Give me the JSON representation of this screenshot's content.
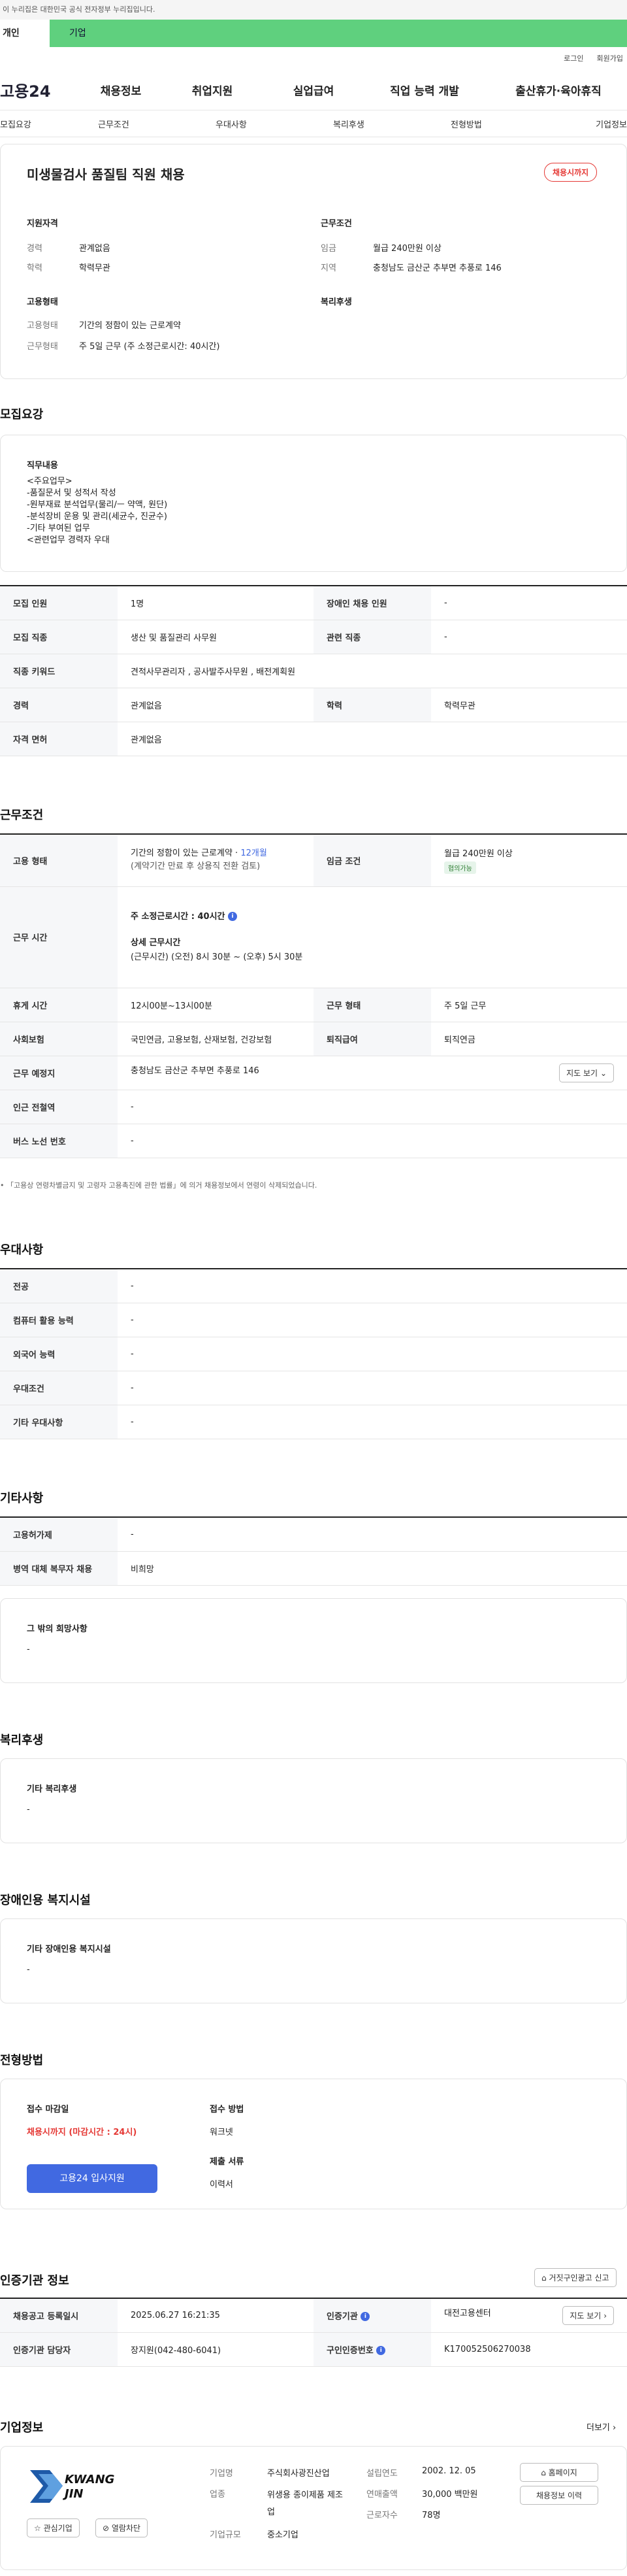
{
  "gov_banner": "이 누리집은 대한민국 공식 전자정부 누리집입니다.",
  "user_tabs": [
    "개인",
    "기업"
  ],
  "top_links": [
    "로그인",
    "회원가입"
  ],
  "logo": "고용24",
  "gnb": [
    "채용정보",
    "취업지원",
    "실업급여",
    "직업 능력 개발",
    "출산휴가·육아휴직"
  ],
  "subnav": [
    "모집요강",
    "근무조건",
    "우대사항",
    "복리후생",
    "전형방법",
    "기업정보"
  ],
  "job_title": "미생물검사 품질팀 직원 채용",
  "status_badge": "채용시까지",
  "summary": {
    "qual_title": "지원자격",
    "cond_title": "근무조건",
    "type_title": "고용형태",
    "welfare_title": "복리후생",
    "career_l": "경력",
    "career_v": "관계없음",
    "edu_l": "학력",
    "edu_v": "학력무관",
    "wage_l": "임금",
    "wage_v": "월급 240만원 이상",
    "area_l": "지역",
    "area_v": "충청남도 금산군 추부면 추풍로 146",
    "emp_l": "고용형태",
    "emp_v": "기간의 정함이 있는 근로계약",
    "work_l": "근무형태",
    "work_v": "주 5일 근무 (주 소정근로시간: 40시간)"
  },
  "recruit": {
    "title": "모집요강",
    "duty_title": "직무내용",
    "duty_lines": [
      "<주요업무>",
      "-품질문서 및 성적서 작성",
      "-원부재료 분석업무(물리/ㅡ 약액, 원단)",
      "-분석장비 운용 및 관리(세균수, 진균수)",
      "-기타 부여된 업무",
      "<관련업무 경력자 우대"
    ],
    "rows": [
      [
        "모집 인원",
        "1명",
        "장애인 채용 인원",
        "-"
      ],
      [
        "모집 직종",
        "생산 및 품질관리 사무원",
        "관련 직종",
        "-"
      ],
      [
        "직종 키워드",
        "견적사무관리자 , 공사발주사무원 , 배전계획원",
        "",
        ""
      ],
      [
        "경력",
        "관계없음",
        "학력",
        "학력무관"
      ],
      [
        "자격 면허",
        "관계없음",
        "",
        ""
      ]
    ]
  },
  "conditions": {
    "title": "근무조건",
    "emp_h": "고용 형태",
    "emp_v1": "기간의 정함이 있는 근로계약 · ",
    "emp_period": "12개월",
    "emp_v2": "(계약기간 만료 후 상용직 전환 검토)",
    "wage_h": "임금 조건",
    "wage_v": "월급 240만원 이상",
    "wage_chip": "협의가능",
    "hours_h": "근무 시간",
    "hours_main": "주 소정근로시간 : 40시간",
    "hours_detail_t": "상세 근무시간",
    "hours_detail": "(근무시간) (오전) 8시 30분 ~ (오후) 5시 30분",
    "break_h": "휴게 시간",
    "break_v": "12시00분~13시00분",
    "form_h": "근무 형태",
    "form_v": "주 5일 근무",
    "ins_h": "사회보험",
    "ins_v": "국민연금, 고용보험, 산재보험, 건강보험",
    "ret_h": "퇴직급여",
    "ret_v": "퇴직연금",
    "place_h": "근무 예정지",
    "place_v": "충청남도 금산군 추부면 추풍로 146",
    "map_btn": "지도 보기",
    "sub_h": "인근 전철역",
    "sub_v": "-",
    "bus_h": "버스 노선 번호",
    "bus_v": "-",
    "note": "「고용상 연령차별금지 및 고령자 고용촉진에 관한 법률」에 의거 채용정보에서 연령이 삭제되었습니다."
  },
  "pref": {
    "title": "우대사항",
    "rows": [
      [
        "전공",
        "-"
      ],
      [
        "컴퓨터 활용 능력",
        "-"
      ],
      [
        "외국어 능력",
        "-"
      ],
      [
        "우대조건",
        "-"
      ],
      [
        "기타 우대사항",
        "-"
      ]
    ]
  },
  "etc": {
    "title": "기타사항",
    "rows": [
      [
        "고용허가제",
        "-"
      ],
      [
        "병역 대체 복무자 채용",
        "비희망"
      ]
    ],
    "other_title": "그 밖의 희망사항",
    "other_v": "-"
  },
  "welfare": {
    "title": "복리후생",
    "sub": "기타 복리후생",
    "v": "-"
  },
  "disab": {
    "title": "장애인용 복지시설",
    "sub": "기타 장애인용 복지시설",
    "v": "-"
  },
  "process": {
    "title": "전형방법",
    "deadline_t": "접수 마감일",
    "deadline_v": "채용시까지 (마감시간 : 24시)",
    "method_t": "접수 방법",
    "method_v": "워크넷",
    "docs_t": "제출 서류",
    "docs_v": "이력서",
    "apply_btn": "고용24 입사지원"
  },
  "agency": {
    "title": "인증기관 정보",
    "report_btn": "거짓구인광고 신고",
    "reg_h": "채용공고 등록일시",
    "reg_v": "2025.06.27 16:21:35",
    "org_h": "인증기관",
    "org_v": "대전고용센터",
    "map_btn": "지도 보기",
    "mgr_h": "인증기관 담당자",
    "mgr_v": "장지원(042-480-6041)",
    "no_h": "구인인증번호",
    "no_v": "K170052506270038"
  },
  "company": {
    "title": "기업정보",
    "more": "더보기",
    "logo_main": "KWANG",
    "logo_sub": "JIN",
    "fav_btn": "관심기업",
    "block_btn": "열람차단",
    "name_l": "기업명",
    "name_v": "주식회사광진산업",
    "ind_l": "업종",
    "ind_v": "위생용 종이제품 제조업",
    "size_l": "기업규모",
    "size_v": "중소기업",
    "year_l": "설립연도",
    "year_v": "2002. 12. 05",
    "sales_l": "연매출액",
    "sales_v": "30,000 백만원",
    "emp_l": "근로자수",
    "emp_v": "78명",
    "home_btn": "홈페이지",
    "hist_btn": "채용정보 이력"
  }
}
